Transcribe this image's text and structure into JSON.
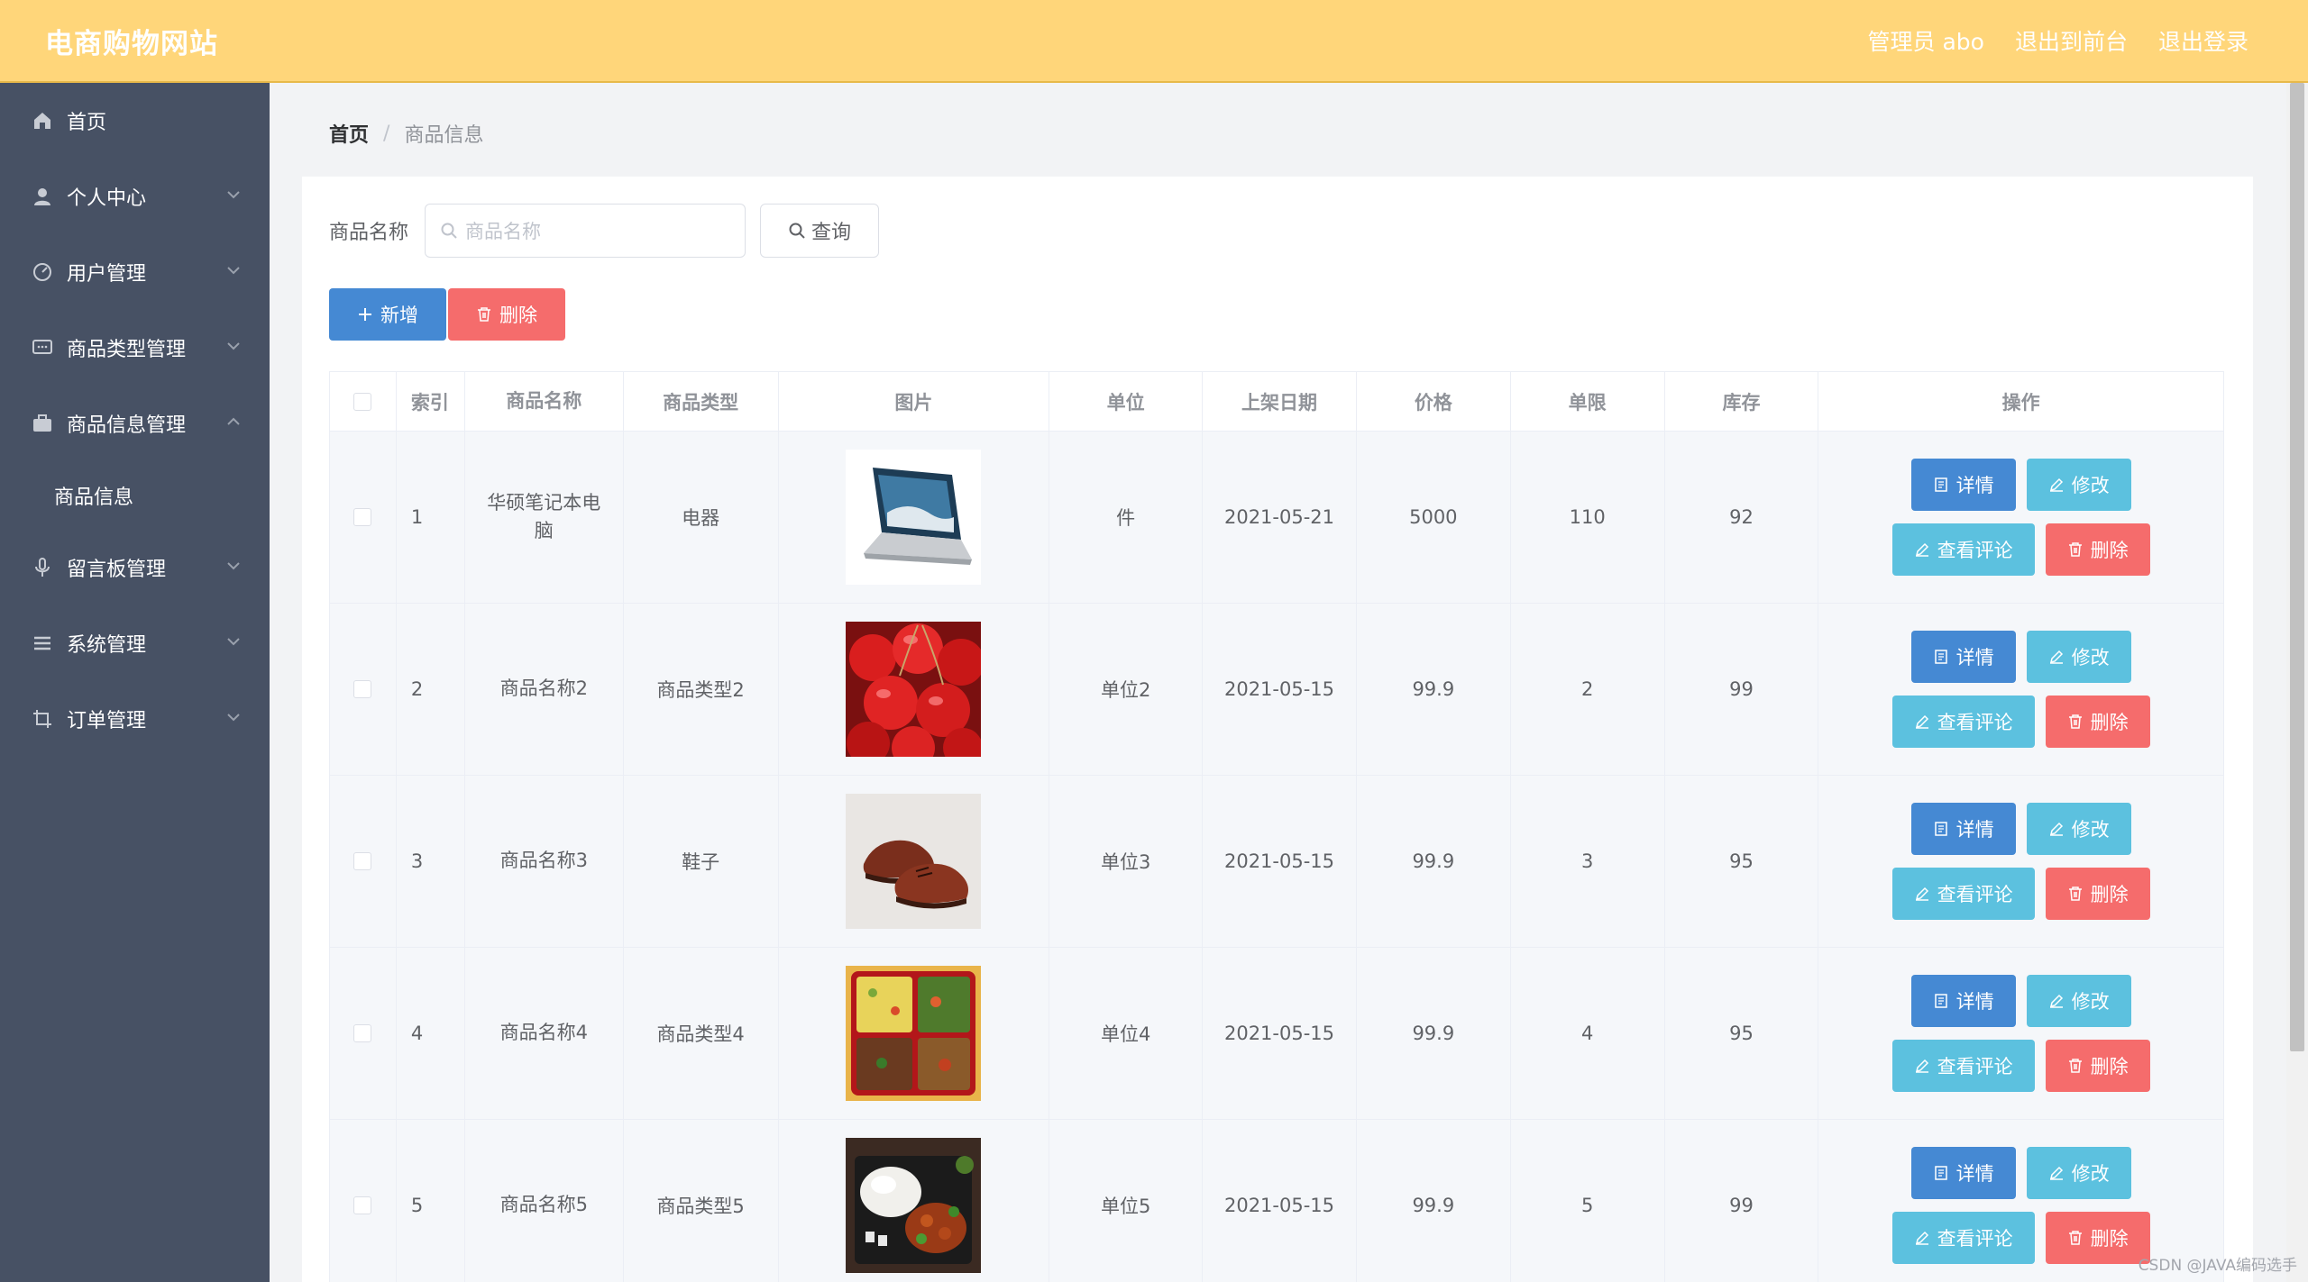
{
  "header": {
    "title": "电商购物网站",
    "links": [
      "管理员 abo",
      "退出到前台",
      "退出登录"
    ]
  },
  "sidebar": {
    "items": [
      {
        "label": "首页",
        "icon": "home-icon",
        "has_arrow": false
      },
      {
        "label": "个人中心",
        "icon": "user-icon",
        "has_arrow": true,
        "expanded": false
      },
      {
        "label": "用户管理",
        "icon": "gauge-icon",
        "has_arrow": true,
        "expanded": false
      },
      {
        "label": "商品类型管理",
        "icon": "chat-icon",
        "has_arrow": true,
        "expanded": false
      },
      {
        "label": "商品信息管理",
        "icon": "briefcase-icon",
        "has_arrow": true,
        "expanded": true
      },
      {
        "label": "商品信息",
        "submenu": true
      },
      {
        "label": "留言板管理",
        "icon": "microphone-icon",
        "has_arrow": true,
        "expanded": false
      },
      {
        "label": "系统管理",
        "icon": "menu-lines-icon",
        "has_arrow": true,
        "expanded": false
      },
      {
        "label": "订单管理",
        "icon": "crop-icon",
        "has_arrow": true,
        "expanded": false
      }
    ]
  },
  "breadcrumb": {
    "home": "首页",
    "separator": "/",
    "current": "商品信息"
  },
  "search": {
    "label": "商品名称",
    "placeholder": "商品名称",
    "button": "查询"
  },
  "actions": {
    "add": "新增",
    "delete": "删除"
  },
  "table": {
    "headers": [
      "索引",
      "商品名称",
      "商品类型",
      "图片",
      "单位",
      "上架日期",
      "价格",
      "单限",
      "库存",
      "操作"
    ],
    "rows": [
      {
        "index": "1",
        "name": "华硕笔记本电脑",
        "type": "电器",
        "image": "laptop",
        "unit": "件",
        "date": "2021-05-21",
        "price": "5000",
        "limit": "110",
        "stock": "92"
      },
      {
        "index": "2",
        "name": "商品名称2",
        "type": "商品类型2",
        "image": "cherries",
        "unit": "单位2",
        "date": "2021-05-15",
        "price": "99.9",
        "limit": "2",
        "stock": "99"
      },
      {
        "index": "3",
        "name": "商品名称3",
        "type": "鞋子",
        "image": "shoes",
        "unit": "单位3",
        "date": "2021-05-15",
        "price": "99.9",
        "limit": "3",
        "stock": "95"
      },
      {
        "index": "4",
        "name": "商品名称4",
        "type": "商品类型4",
        "image": "bento",
        "unit": "单位4",
        "date": "2021-05-15",
        "price": "99.9",
        "limit": "4",
        "stock": "95"
      },
      {
        "index": "5",
        "name": "商品名称5",
        "type": "商品类型5",
        "image": "rice-meal",
        "unit": "单位5",
        "date": "2021-05-15",
        "price": "99.9",
        "limit": "5",
        "stock": "99"
      }
    ],
    "row_actions": {
      "detail": "详情",
      "edit": "修改",
      "comment": "查看评论",
      "delete": "删除"
    }
  },
  "watermark": "CSDN @JAVA编码选手",
  "colors": {
    "header": "#ffd67a",
    "sidebar": "#475164",
    "primary": "#4589d3",
    "info": "#5cc1df",
    "danger": "#f56c6c"
  }
}
